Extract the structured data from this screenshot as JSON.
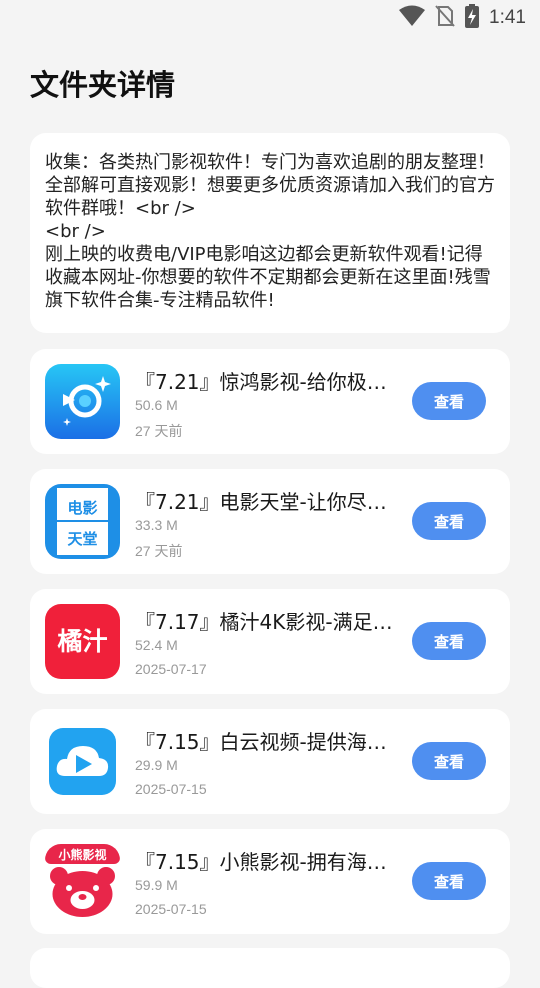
{
  "status": {
    "time": "1:41",
    "icons": [
      "wifi-icon",
      "no-sim-icon",
      "battery-charging-icon"
    ]
  },
  "page": {
    "title": "文件夹详情"
  },
  "description": "收集：各类热门影视软件！专门为喜欢追剧的朋友整理！全部解可直接观影！想要更多优质资源请加入我们的官方软件群哦！<br />\n<br />\n刚上映的收费电/VIP电影咱这边都会更新软件观看!记得收藏本网址-你想要的软件不定期都会更新在这里面!残雪旗下软件合集-专注精品软件!",
  "apps": [
    {
      "title": "『7.21』惊鸿影视-给你极…",
      "size": "50.6 M",
      "date": "27 天前",
      "icon": "jinghong-app-icon",
      "button": "查看"
    },
    {
      "title": "『7.21』电影天堂-让你尽…",
      "size": "33.3 M",
      "date": "27 天前",
      "icon": "dianying-tiantang-app-icon",
      "icon_text": [
        "电影",
        "天堂"
      ],
      "button": "查看"
    },
    {
      "title": "『7.17』橘汁4K影视-满足…",
      "size": "52.4 M",
      "date": "2025-07-17",
      "icon": "juzhi-app-icon",
      "icon_text": "橘汁",
      "button": "查看"
    },
    {
      "title": "『7.15』白云视频-提供海…",
      "size": "29.9 M",
      "date": "2025-07-15",
      "icon": "baiyun-app-icon",
      "button": "查看"
    },
    {
      "title": "『7.15』小熊影视-拥有海…",
      "size": "59.9 M",
      "date": "2025-07-15",
      "icon": "xiaoxiong-app-icon",
      "icon_text": "小熊影视",
      "button": "查看"
    }
  ],
  "colors": {
    "accent": "#4f8ff0",
    "background": "#f4f4f4",
    "card": "#ffffff"
  }
}
